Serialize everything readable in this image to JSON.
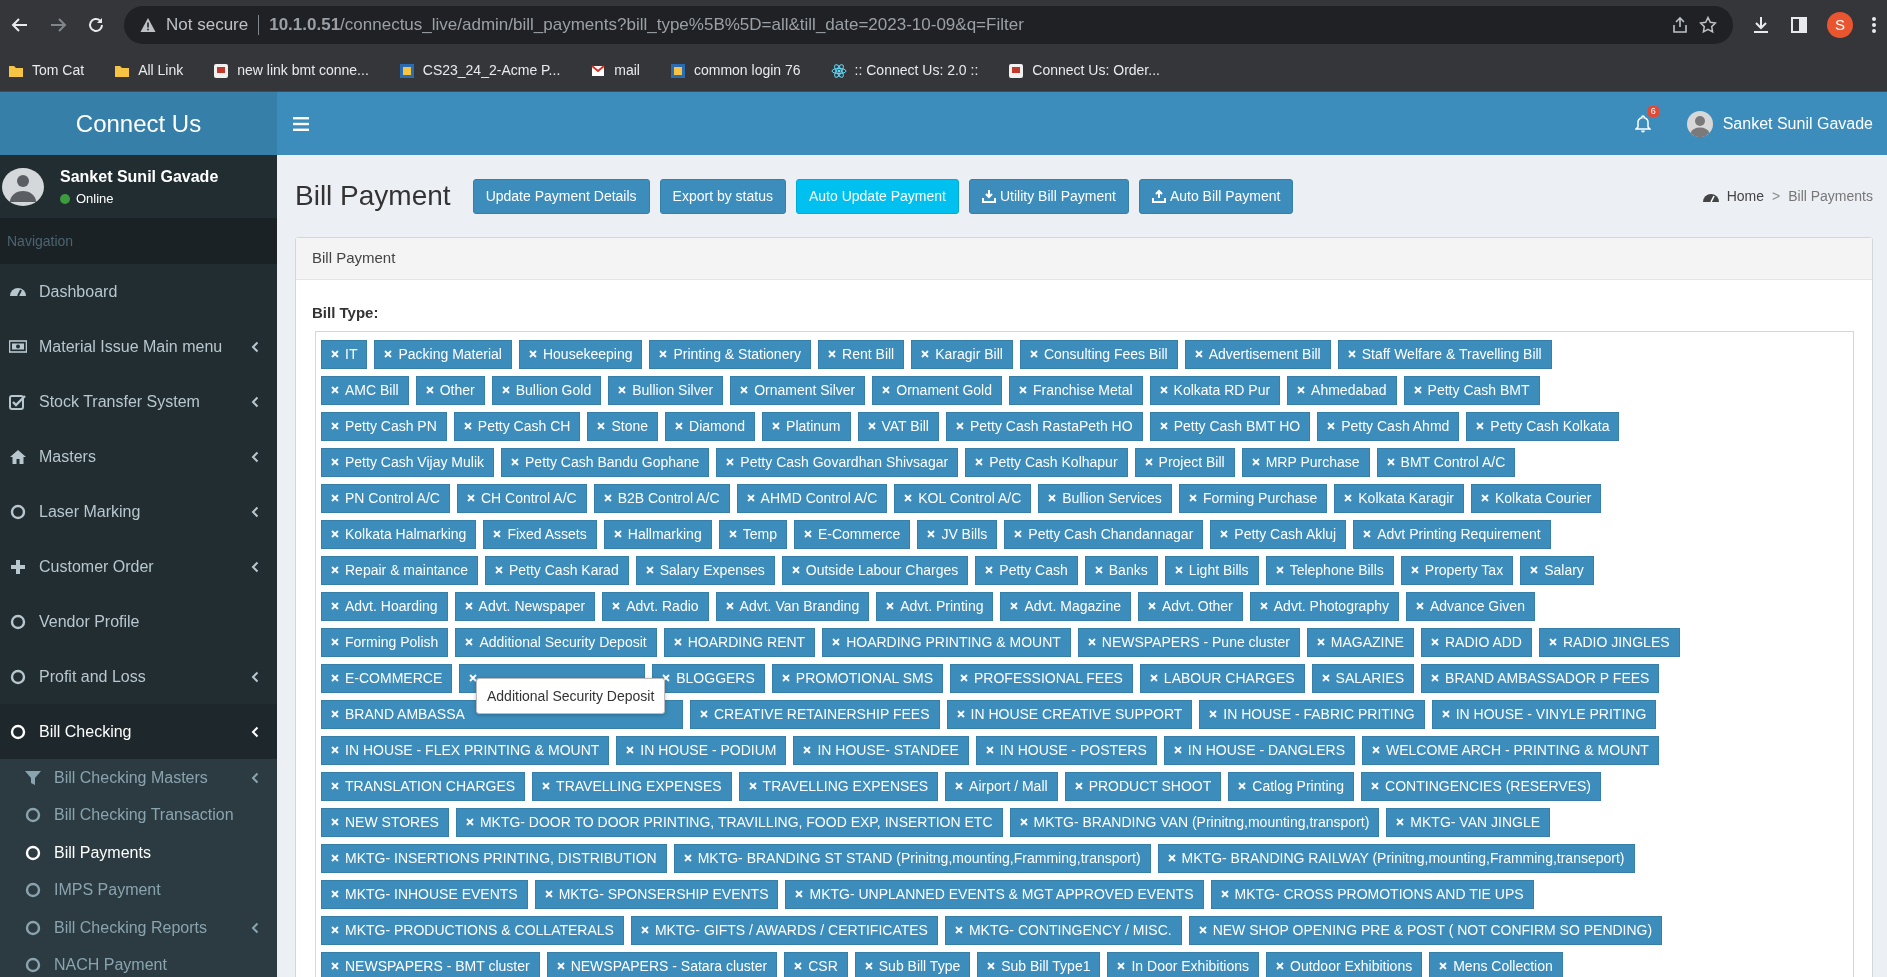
{
  "browser": {
    "security": "Not secure",
    "url": "**10.1.0.51**/connectus_live/admin/bill_payments?bill_type%5B%5D=all&till_date=2023-10-09&q=Filter",
    "profile_initial": "S",
    "bookmarks": [
      {
        "label": "Tom Cat",
        "kind": "folder"
      },
      {
        "label": "All Link",
        "kind": "folder"
      },
      {
        "label": "new link bmt conne...",
        "kind": "site"
      },
      {
        "label": "CS23_24_2-Acme P...",
        "kind": "site"
      },
      {
        "label": "mail",
        "kind": "site"
      },
      {
        "label": "common login 76",
        "kind": "site"
      },
      {
        "label": ":: Connect Us: 2.0 ::",
        "kind": "site"
      },
      {
        "label": "Connect Us: Order...",
        "kind": "site"
      }
    ]
  },
  "header": {
    "brand": "Connect Us",
    "notification_count": "6",
    "user_name": "Sanket Sunil Gavade"
  },
  "sidebar": {
    "user_name": "Sanket Sunil Gavade",
    "status": "Online",
    "section": "Navigation",
    "items": [
      {
        "label": "Dashboard",
        "expandable": false,
        "selected": false
      },
      {
        "label": "Material Issue Main menu",
        "expandable": true,
        "selected": false
      },
      {
        "label": "Stock Transfer System",
        "expandable": true,
        "selected": false
      },
      {
        "label": "Masters",
        "expandable": true,
        "selected": false
      },
      {
        "label": "Laser Marking",
        "expandable": true,
        "selected": false
      },
      {
        "label": "Customer Order",
        "expandable": true,
        "selected": false
      },
      {
        "label": "Vendor Profile",
        "expandable": false,
        "selected": false
      },
      {
        "label": "Profit and Loss",
        "expandable": true,
        "selected": false
      },
      {
        "label": "Bill Checking",
        "expandable": true,
        "selected": true,
        "children": [
          {
            "label": "Bill Checking Masters",
            "expandable": true,
            "selected": false
          },
          {
            "label": "Bill Checking Transaction",
            "expandable": false,
            "selected": false
          },
          {
            "label": "Bill Payments",
            "expandable": false,
            "selected": true
          },
          {
            "label": "IMPS Payment",
            "expandable": false,
            "selected": false
          },
          {
            "label": "Bill Checking Reports",
            "expandable": true,
            "selected": false
          },
          {
            "label": "NACH Payment",
            "expandable": false,
            "selected": false
          }
        ]
      }
    ]
  },
  "page": {
    "title": "Bill Payment",
    "buttons": [
      {
        "label": "Update Payment Details",
        "kind": "primary"
      },
      {
        "label": "Export by status",
        "kind": "primary"
      },
      {
        "label": "Auto Update Payment",
        "kind": "info"
      },
      {
        "label": "Utility Bill Payment",
        "kind": "primary"
      },
      {
        "label": "Auto Bill Payment",
        "kind": "primary"
      }
    ],
    "breadcrumb": [
      {
        "label": "Home"
      },
      {
        "label": "Bill Payments"
      }
    ],
    "breadcrumb_separator": ">"
  },
  "card": {
    "title": "Bill Payment",
    "field_label": "Bill Type:",
    "tooltip": "Additional Security Deposit",
    "tag_rows": [
      [
        "IT",
        "Packing Material",
        "Housekeeping",
        "Printing & Stationery",
        "Rent Bill",
        "Karagir Bill",
        "Consulting Fees Bill",
        "Advertisement Bill",
        "Staff Welfare & Travelling Bill"
      ],
      [
        "AMC Bill",
        "Other",
        "Bullion Gold",
        "Bullion Silver",
        "Ornament Silver",
        "Ornament Gold",
        "Franchise Metal",
        "Kolkata RD Pur",
        "Ahmedabad",
        "Petty Cash BMT"
      ],
      [
        "Petty Cash PN",
        "Petty Cash CH",
        "Stone",
        "Diamond",
        "Platinum",
        "VAT Bill",
        "Petty Cash RastaPeth HO",
        "Petty Cash BMT HO",
        "Petty Cash Ahmd",
        "Petty Cash Kolkata"
      ],
      [
        "Petty Cash Vijay Mulik",
        "Petty Cash Bandu Gophane",
        "Petty Cash Govardhan Shivsagar",
        "Petty Cash Kolhapur",
        "Project Bill",
        "MRP Purchase",
        "BMT Control A/C"
      ],
      [
        "PN Control A/C",
        "CH Control A/C",
        "B2B Control A/C",
        "AHMD Control A/C",
        "KOL Control A/C",
        "Bullion Services",
        "Forming Purchase",
        "Kolkata Karagir",
        "Kolkata Courier"
      ],
      [
        "Kolkata Halmarking",
        "Fixed Assets",
        "Hallmarking",
        "Temp",
        "E-Commerce",
        "JV Bills",
        "Petty Cash Chandannagar",
        "Petty Cash Akluj",
        "Advt Printing Requirement"
      ],
      [
        "Repair & maintance",
        "Petty Cash Karad",
        "Salary Expenses",
        "Outside Labour Charges",
        "Petty Cash",
        "Banks",
        "Light Bills",
        "Telephone Bills",
        "Property Tax",
        "Salary"
      ],
      [
        "Advt. Hoarding",
        "Advt. Newspaper",
        "Advt. Radio",
        "Advt. Van Branding",
        "Advt. Printing",
        "Advt. Magazine",
        "Advt. Other",
        "Advt. Photography",
        "Advance Given"
      ],
      [
        "Forming Polish",
        "Additional Security Deposit",
        "HOARDING RENT",
        "HOARDING PRINTING & MOUNT",
        "NEWSPAPERS - Pune cluster",
        "MAGAZINE",
        "RADIO ADD",
        "RADIO JINGLES"
      ],
      [
        "E-COMMERCE",
        {
          "covered": true
        },
        "BLOGGERS",
        "PROMOTIONAL SMS",
        "PROFESSIONAL FEES",
        "LABOUR CHARGES",
        "SALARIES",
        "BRAND AMBASSADOR P FEES"
      ],
      [
        {
          "label": "BRAND AMBASSA",
          "cut": true
        },
        "CREATIVE RETAINERSHIP FEES",
        "IN HOUSE CREATIVE SUPPORT",
        "IN HOUSE - FABRIC PRITING",
        "IN HOUSE - VINYLE PRITING"
      ],
      [
        "IN HOUSE - FLEX PRINTING & MOUNT",
        "IN HOUSE - PODIUM",
        "IN HOUSE- STANDEE",
        "IN HOUSE - POSTERS",
        "IN HOUSE - DANGLERS",
        "WELCOME ARCH - PRINTING & MOUNT"
      ],
      [
        "TRANSLATION CHARGES",
        "TRAVELLING EXPENSES",
        "TRAVELLING EXPENSES",
        "Airport / Mall",
        "PRODUCT SHOOT",
        "Catlog Printing",
        "CONTINGENCIES (RESERVES)"
      ],
      [
        "NEW STORES",
        "MKTG- DOOR TO DOOR PRINTING, TRAVILLING, FOOD EXP, INSERTION ETC",
        "MKTG- BRANDING VAN (Prinitng,mounting,transport)",
        "MKTG- VAN JINGLE"
      ],
      [
        "MKTG- INSERTIONS PRINTING, DISTRIBUTION",
        "MKTG- BRANDING ST STAND (Prinitng,mounting,Framming,transport)",
        "MKTG- BRANDING RAILWAY (Prinitng,mounting,Framming,transeport)"
      ],
      [
        "MKTG- INHOUSE EVENTS",
        "MKTG- SPONSERSHIP EVENTS",
        "MKTG- UNPLANNED EVENTS & MGT APPROVED EVENTS",
        "MKTG- CROSS PROMOTIONS AND TIE UPS"
      ],
      [
        "MKTG- PRODUCTIONS & COLLATERALS",
        "MKTG- GIFTS / AWARDS / CERTIFICATES",
        "MKTG- CONTINGENCY / MISC.",
        "NEW SHOP OPENING PRE & POST ( NOT CONFIRM SO PENDING)"
      ],
      [
        "NEWSPAPERS - BMT cluster",
        "NEWSPAPERS - Satara cluster",
        "CSR",
        "Sub Bill Type",
        "Sub Bill Type1",
        "In Door Exhibitions",
        "Outdoor Exhibitions",
        "Mens Collection"
      ]
    ]
  }
}
